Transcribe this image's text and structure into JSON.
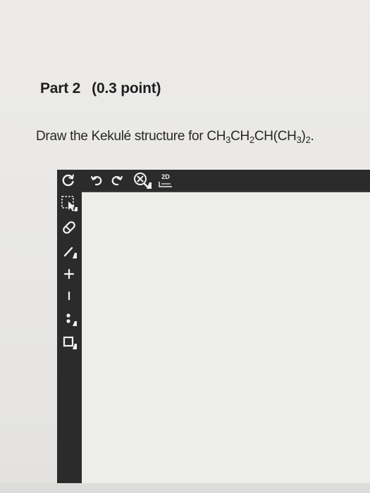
{
  "part": {
    "label": "Part 2",
    "points": "(0.3 point)"
  },
  "question": {
    "prefix": "Draw the Kekulé structure for CH",
    "sub1": "3",
    "mid1": "CH",
    "sub2": "2",
    "mid2": "CH(CH",
    "sub3": "3",
    "mid3": ")",
    "sub4": "2",
    "suffix": "."
  },
  "toolbar": {
    "mode_badge": "2D"
  },
  "colors": {
    "toolbar": "#2b2b2b",
    "canvas": "#ededeb",
    "icon": "#f2f2f2"
  }
}
